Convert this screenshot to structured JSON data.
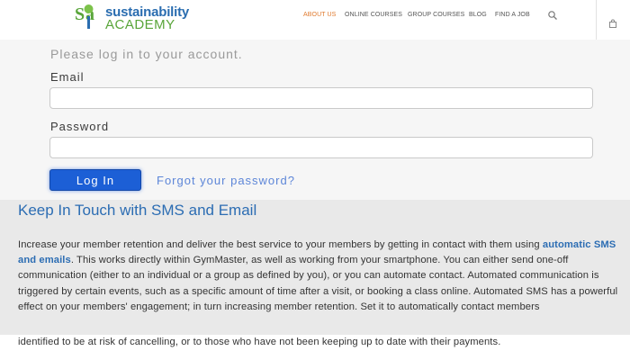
{
  "header": {
    "logo": {
      "line1": "sustainability",
      "line2": "ACADEMY"
    },
    "nav": [
      {
        "label": "ABOUT US",
        "active": true
      },
      {
        "label": "ONLINE COURSES",
        "active": false
      },
      {
        "label": "GROUP COURSES",
        "active": false
      },
      {
        "label": "BLOG",
        "active": false
      },
      {
        "label": "FIND A JOB",
        "active": false
      }
    ],
    "icons": {
      "search": "search-icon",
      "cart": "shopping-bag-icon"
    }
  },
  "login": {
    "intro": "Please log in to your account.",
    "email_label": "Email",
    "email_value": "",
    "password_label": "Password",
    "password_value": "",
    "submit_label": "Log In",
    "forgot_label": "Forgot your password?"
  },
  "article": {
    "title": "Keep In Touch with SMS and Email",
    "body_prefix": "Increase your member retention and deliver the best service to your members by getting in contact with them using ",
    "body_link": "automatic SMS and emails",
    "body_suffix": ". This works directly within GymMaster, as well as working from your smartphone. You can either send one-off communication (either to an individual or a group as defined by you), or you can automate contact. Automated communication is triggered by certain events, such as a specific amount of time after a visit, or booking a class online. Automated SMS has a powerful effect on your members' engagement; in turn increasing member retention. Set it to automatically contact members",
    "body_last_line": "identified to be at risk of cancelling, or to those who have not been keeping up to date with their payments."
  },
  "colors": {
    "brand_blue": "#2a6db0",
    "brand_green": "#59a53a",
    "nav_active": "#e07a2e",
    "button_blue": "#1c5fd6",
    "link_blue": "#2c6db3"
  }
}
